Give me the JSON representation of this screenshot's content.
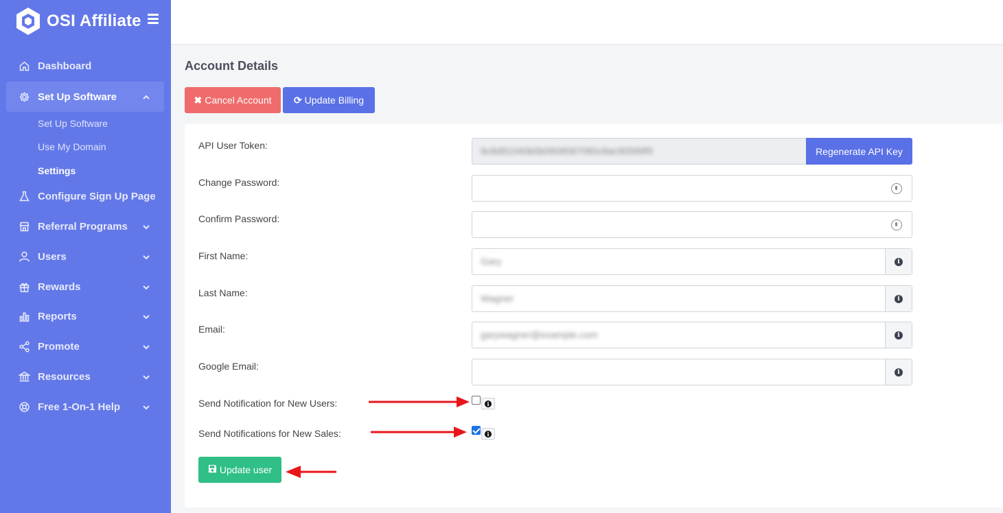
{
  "brand": {
    "name": "OSI Affiliate"
  },
  "sidebar": {
    "items": [
      {
        "label": "Dashboard",
        "icon": "home-icon"
      },
      {
        "label": "Set Up Software",
        "icon": "gear-icon",
        "expanded": true,
        "children": [
          {
            "label": "Set Up Software"
          },
          {
            "label": "Use My Domain"
          },
          {
            "label": "Settings",
            "current": true
          }
        ]
      },
      {
        "label": "Configure Sign Up Page",
        "icon": "flask-icon"
      },
      {
        "label": "Referral Programs",
        "icon": "store-icon"
      },
      {
        "label": "Users",
        "icon": "user-icon"
      },
      {
        "label": "Rewards",
        "icon": "gift-icon"
      },
      {
        "label": "Reports",
        "icon": "bar-chart-icon"
      },
      {
        "label": "Promote",
        "icon": "share-icon"
      },
      {
        "label": "Resources",
        "icon": "bank-icon"
      },
      {
        "label": "Free 1-On-1 Help",
        "icon": "lifebuoy-icon"
      }
    ]
  },
  "page": {
    "title": "Account Details",
    "cancel_button": "Cancel Account",
    "billing_button": "Update Billing"
  },
  "form": {
    "api_token": {
      "label": "API User Token:",
      "value": "9c8d91040b0b0608587080c8ac90589f9",
      "regenerate": "Regenerate API Key"
    },
    "change_password": {
      "label": "Change Password:"
    },
    "confirm_password": {
      "label": "Confirm Password:"
    },
    "first_name": {
      "label": "First Name:",
      "value": "Gary"
    },
    "last_name": {
      "label": "Last Name:",
      "value": "Wagner"
    },
    "email": {
      "label": "Email:",
      "value": "garywagner@example.com"
    },
    "google_email": {
      "label": "Google Email:",
      "value": ""
    },
    "notify_users": {
      "label": "Send Notification for New Users:",
      "checked": false
    },
    "notify_sales": {
      "label": "Send Notifications for New Sales:",
      "checked": true
    },
    "update_button": "Update user"
  },
  "colors": {
    "sidebar": "#6378e8",
    "primary": "#5a70e6",
    "danger": "#f06b6b",
    "success": "#2fbf87",
    "annotation": "#e8151b"
  }
}
